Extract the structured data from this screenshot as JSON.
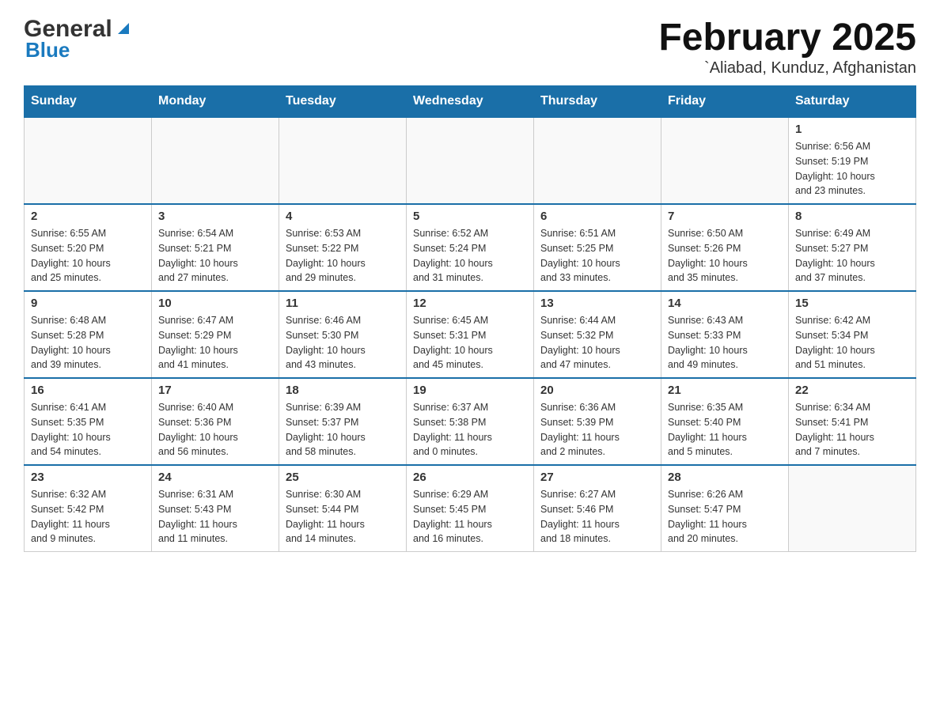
{
  "header": {
    "logo_general": "General",
    "logo_blue": "Blue",
    "title": "February 2025",
    "location": "`Aliabad, Kunduz, Afghanistan"
  },
  "days_of_week": [
    "Sunday",
    "Monday",
    "Tuesday",
    "Wednesday",
    "Thursday",
    "Friday",
    "Saturday"
  ],
  "weeks": [
    [
      {
        "day": "",
        "info": ""
      },
      {
        "day": "",
        "info": ""
      },
      {
        "day": "",
        "info": ""
      },
      {
        "day": "",
        "info": ""
      },
      {
        "day": "",
        "info": ""
      },
      {
        "day": "",
        "info": ""
      },
      {
        "day": "1",
        "info": "Sunrise: 6:56 AM\nSunset: 5:19 PM\nDaylight: 10 hours\nand 23 minutes."
      }
    ],
    [
      {
        "day": "2",
        "info": "Sunrise: 6:55 AM\nSunset: 5:20 PM\nDaylight: 10 hours\nand 25 minutes."
      },
      {
        "day": "3",
        "info": "Sunrise: 6:54 AM\nSunset: 5:21 PM\nDaylight: 10 hours\nand 27 minutes."
      },
      {
        "day": "4",
        "info": "Sunrise: 6:53 AM\nSunset: 5:22 PM\nDaylight: 10 hours\nand 29 minutes."
      },
      {
        "day": "5",
        "info": "Sunrise: 6:52 AM\nSunset: 5:24 PM\nDaylight: 10 hours\nand 31 minutes."
      },
      {
        "day": "6",
        "info": "Sunrise: 6:51 AM\nSunset: 5:25 PM\nDaylight: 10 hours\nand 33 minutes."
      },
      {
        "day": "7",
        "info": "Sunrise: 6:50 AM\nSunset: 5:26 PM\nDaylight: 10 hours\nand 35 minutes."
      },
      {
        "day": "8",
        "info": "Sunrise: 6:49 AM\nSunset: 5:27 PM\nDaylight: 10 hours\nand 37 minutes."
      }
    ],
    [
      {
        "day": "9",
        "info": "Sunrise: 6:48 AM\nSunset: 5:28 PM\nDaylight: 10 hours\nand 39 minutes."
      },
      {
        "day": "10",
        "info": "Sunrise: 6:47 AM\nSunset: 5:29 PM\nDaylight: 10 hours\nand 41 minutes."
      },
      {
        "day": "11",
        "info": "Sunrise: 6:46 AM\nSunset: 5:30 PM\nDaylight: 10 hours\nand 43 minutes."
      },
      {
        "day": "12",
        "info": "Sunrise: 6:45 AM\nSunset: 5:31 PM\nDaylight: 10 hours\nand 45 minutes."
      },
      {
        "day": "13",
        "info": "Sunrise: 6:44 AM\nSunset: 5:32 PM\nDaylight: 10 hours\nand 47 minutes."
      },
      {
        "day": "14",
        "info": "Sunrise: 6:43 AM\nSunset: 5:33 PM\nDaylight: 10 hours\nand 49 minutes."
      },
      {
        "day": "15",
        "info": "Sunrise: 6:42 AM\nSunset: 5:34 PM\nDaylight: 10 hours\nand 51 minutes."
      }
    ],
    [
      {
        "day": "16",
        "info": "Sunrise: 6:41 AM\nSunset: 5:35 PM\nDaylight: 10 hours\nand 54 minutes."
      },
      {
        "day": "17",
        "info": "Sunrise: 6:40 AM\nSunset: 5:36 PM\nDaylight: 10 hours\nand 56 minutes."
      },
      {
        "day": "18",
        "info": "Sunrise: 6:39 AM\nSunset: 5:37 PM\nDaylight: 10 hours\nand 58 minutes."
      },
      {
        "day": "19",
        "info": "Sunrise: 6:37 AM\nSunset: 5:38 PM\nDaylight: 11 hours\nand 0 minutes."
      },
      {
        "day": "20",
        "info": "Sunrise: 6:36 AM\nSunset: 5:39 PM\nDaylight: 11 hours\nand 2 minutes."
      },
      {
        "day": "21",
        "info": "Sunrise: 6:35 AM\nSunset: 5:40 PM\nDaylight: 11 hours\nand 5 minutes."
      },
      {
        "day": "22",
        "info": "Sunrise: 6:34 AM\nSunset: 5:41 PM\nDaylight: 11 hours\nand 7 minutes."
      }
    ],
    [
      {
        "day": "23",
        "info": "Sunrise: 6:32 AM\nSunset: 5:42 PM\nDaylight: 11 hours\nand 9 minutes."
      },
      {
        "day": "24",
        "info": "Sunrise: 6:31 AM\nSunset: 5:43 PM\nDaylight: 11 hours\nand 11 minutes."
      },
      {
        "day": "25",
        "info": "Sunrise: 6:30 AM\nSunset: 5:44 PM\nDaylight: 11 hours\nand 14 minutes."
      },
      {
        "day": "26",
        "info": "Sunrise: 6:29 AM\nSunset: 5:45 PM\nDaylight: 11 hours\nand 16 minutes."
      },
      {
        "day": "27",
        "info": "Sunrise: 6:27 AM\nSunset: 5:46 PM\nDaylight: 11 hours\nand 18 minutes."
      },
      {
        "day": "28",
        "info": "Sunrise: 6:26 AM\nSunset: 5:47 PM\nDaylight: 11 hours\nand 20 minutes."
      },
      {
        "day": "",
        "info": ""
      }
    ]
  ]
}
